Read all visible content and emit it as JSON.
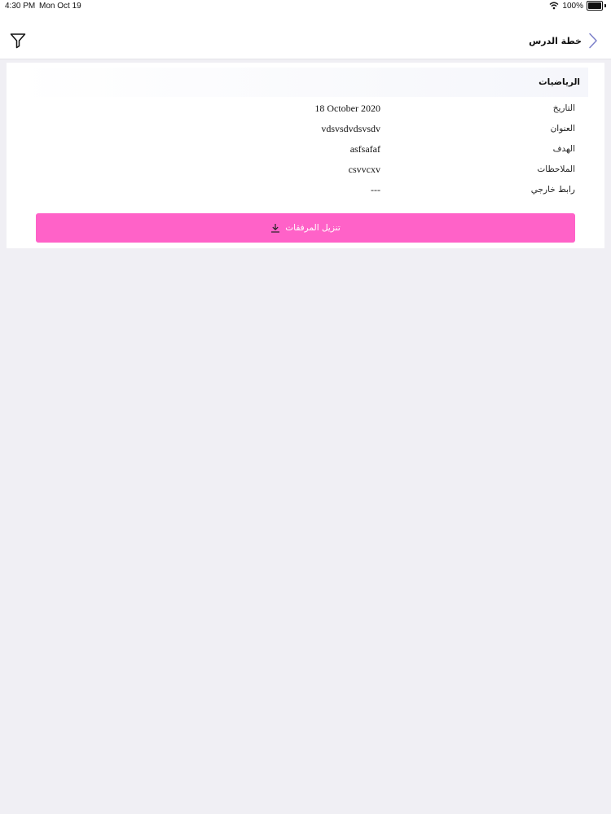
{
  "status_bar": {
    "time": "4:30 PM",
    "date": "Mon Oct 19",
    "battery": "100%",
    "battery_level": 1.0
  },
  "nav": {
    "title": "خطة الدرس",
    "back_icon": "chevron-right-icon",
    "filter_icon": "filter-icon"
  },
  "card": {
    "subject": "الرياضيات",
    "rows": [
      {
        "label": "التاريخ",
        "value": "18 October 2020"
      },
      {
        "label": "العنوان",
        "value": "vdsvsdvdsvsdv"
      },
      {
        "label": "الهدف",
        "value": "asfsafaf"
      },
      {
        "label": "الملاحظات",
        "value": "csvvcxv"
      },
      {
        "label": "رابط خارجي",
        "value": "---"
      }
    ],
    "download_label": "تنزيل المرفقات",
    "download_icon": "download-icon"
  },
  "colors": {
    "accent": "#ff62c8",
    "background": "#f0eff4",
    "chevron": "#7b7fc9"
  }
}
